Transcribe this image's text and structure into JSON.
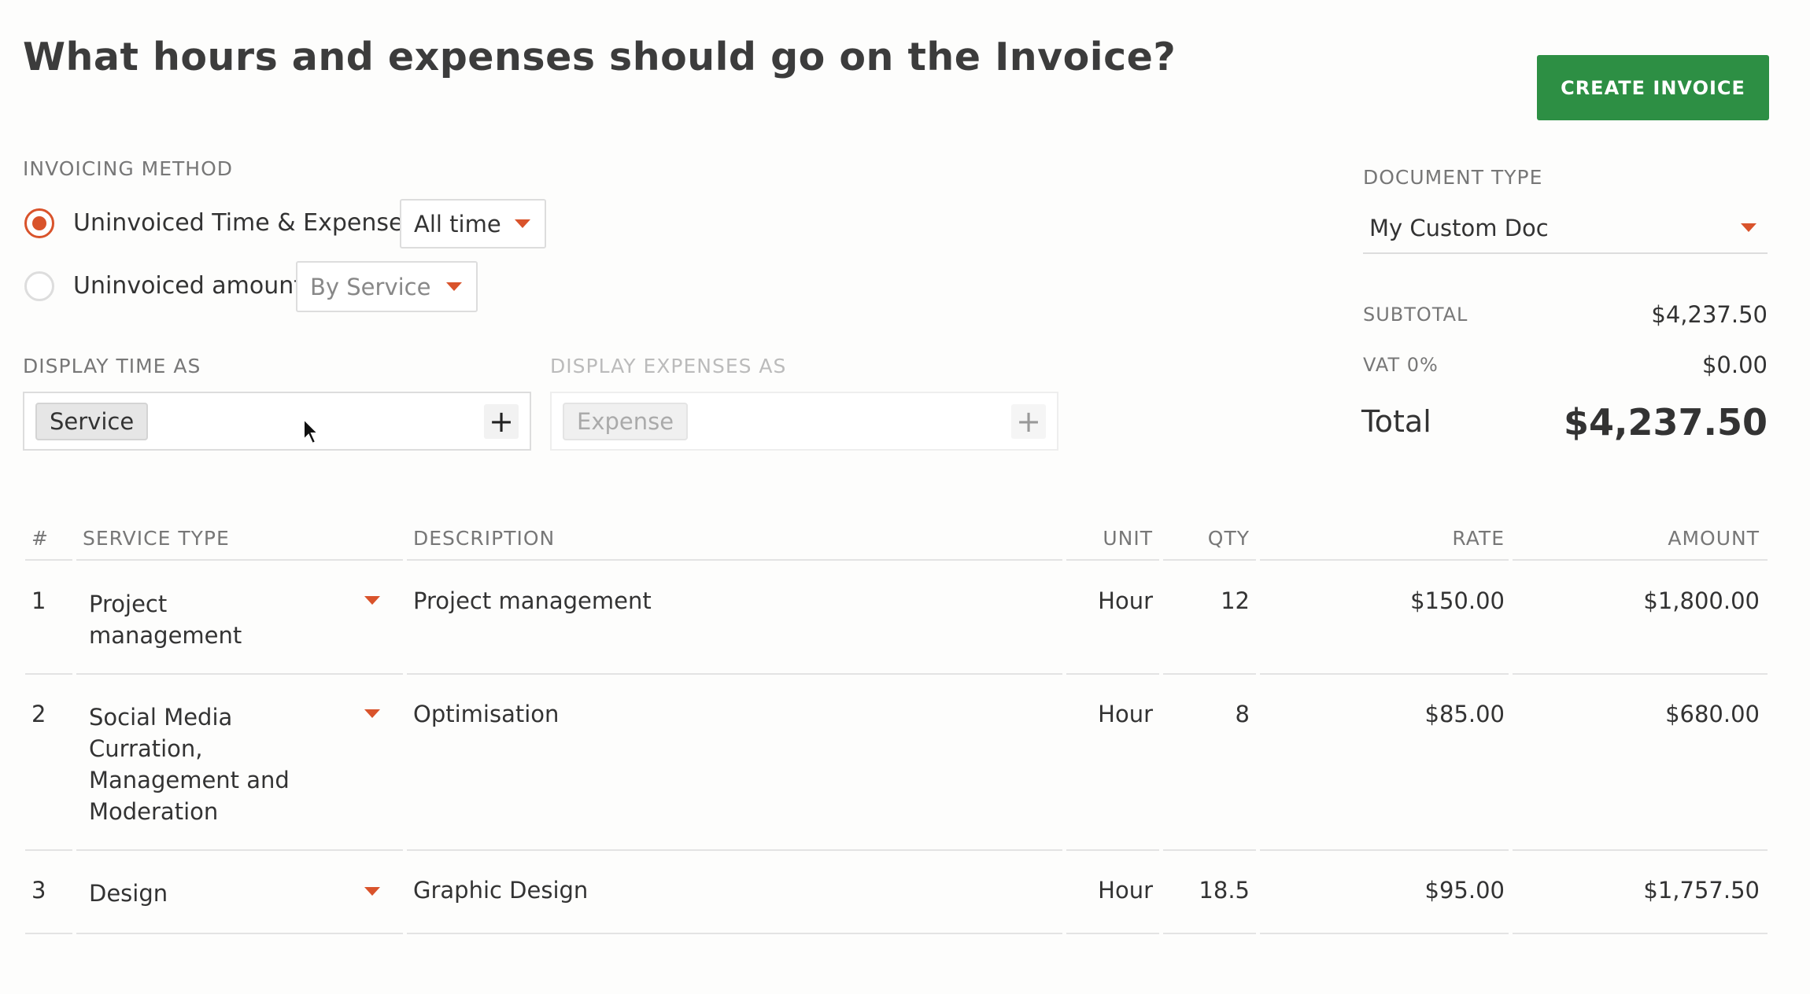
{
  "title": "What hours and expenses should go on the Invoice?",
  "create_button": "CREATE INVOICE",
  "invoicing_method": {
    "label": "INVOICING METHOD",
    "options": [
      {
        "label": "Uninvoiced Time & Expenses",
        "checked": true,
        "select": "All time"
      },
      {
        "label": "Uninvoiced amount",
        "checked": false,
        "select": "By Service"
      }
    ]
  },
  "display_time": {
    "label": "DISPLAY TIME AS",
    "tag": "Service",
    "add": "+"
  },
  "display_expenses": {
    "label": "DISPLAY EXPENSES AS",
    "tag": "Expense",
    "add": "+"
  },
  "document_type": {
    "label": "DOCUMENT TYPE",
    "value": "My Custom Doc"
  },
  "summary": {
    "subtotal_label": "SUBTOTAL",
    "subtotal": "$4,237.50",
    "vat_label": "VAT 0%",
    "vat": "$0.00",
    "total_label": "Total",
    "total": "$4,237.50"
  },
  "table": {
    "headers": {
      "num": "#",
      "service": "SERVICE TYPE",
      "description": "DESCRIPTION",
      "unit": "UNIT",
      "qty": "QTY",
      "rate": "RATE",
      "amount": "AMOUNT"
    },
    "rows": [
      {
        "num": "1",
        "service": "Project management",
        "description": "Project management",
        "unit": "Hour",
        "qty": "12",
        "rate": "$150.00",
        "amount": "$1,800.00"
      },
      {
        "num": "2",
        "service": "Social Media Curration, Management and Moderation",
        "description": "Optimisation",
        "unit": "Hour",
        "qty": "8",
        "rate": "$85.00",
        "amount": "$680.00"
      },
      {
        "num": "3",
        "service": "Design",
        "description": "Graphic Design",
        "unit": "Hour",
        "qty": "18.5",
        "rate": "$95.00",
        "amount": "$1,757.50"
      }
    ]
  },
  "colors": {
    "accent": "#d9532b",
    "primary_button": "#2d8f44"
  }
}
